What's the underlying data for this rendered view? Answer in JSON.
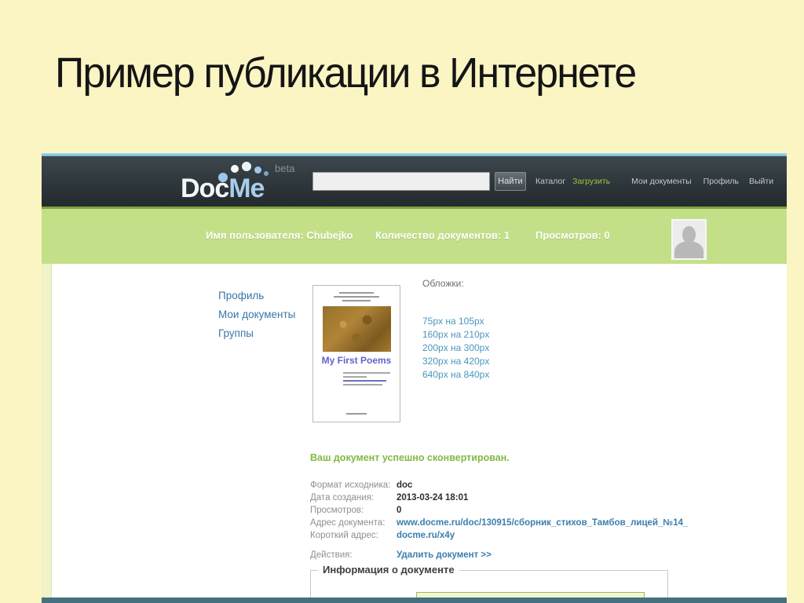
{
  "slide": {
    "title": "Пример публикации в Интернете"
  },
  "colors": {
    "slide_bg": "#fbf5c4",
    "header_bg": "#2c3539",
    "green_bar": "#c3e089",
    "accent_green": "#9fc43c",
    "link_blue": "#3a7fad",
    "success_green": "#82b944",
    "top_edge_blue": "#6fb7d4",
    "bottom_edge_teal": "#44707f"
  },
  "header": {
    "logo_part1": "Doc",
    "logo_part2": "Me",
    "logo_beta": "beta",
    "search_button": "Найти",
    "nav": [
      "Каталог",
      "Загрузить",
      "Мои документы",
      "Профиль",
      "Выйти"
    ]
  },
  "userbar": {
    "username": "Имя пользователя: Chubejko",
    "documents": "Количество документов: 1",
    "views": "Просмотров: 0"
  },
  "sidebar": [
    "Профиль",
    "Мои документы",
    "Группы"
  ],
  "main": {
    "cover_title": "My First Poems",
    "covers_label": "Обложки:",
    "cover_sizes": [
      "75px на 105px",
      "160px на 210px",
      "200px на 300px",
      "320px на 420px",
      "640px на 840px"
    ],
    "success": "Ваш документ успешно сконвертирован.",
    "details": [
      {
        "label": "Формат исходника:",
        "value": "doc"
      },
      {
        "label": "Дата создания:",
        "value": "2013-03-24 18:01"
      },
      {
        "label": "Просмотров:",
        "value": "0"
      },
      {
        "label": "Адрес документа:",
        "value": "www.docme.ru/doc/130915/сборник_стихов_Тамбов_лицей_№14_"
      },
      {
        "label": "Короткий адрес:",
        "value": "docme.ru/x4y"
      }
    ],
    "actions_label": "Действия:",
    "delete_link": "Удалить документ >>",
    "info_legend": "Информация о документе"
  }
}
